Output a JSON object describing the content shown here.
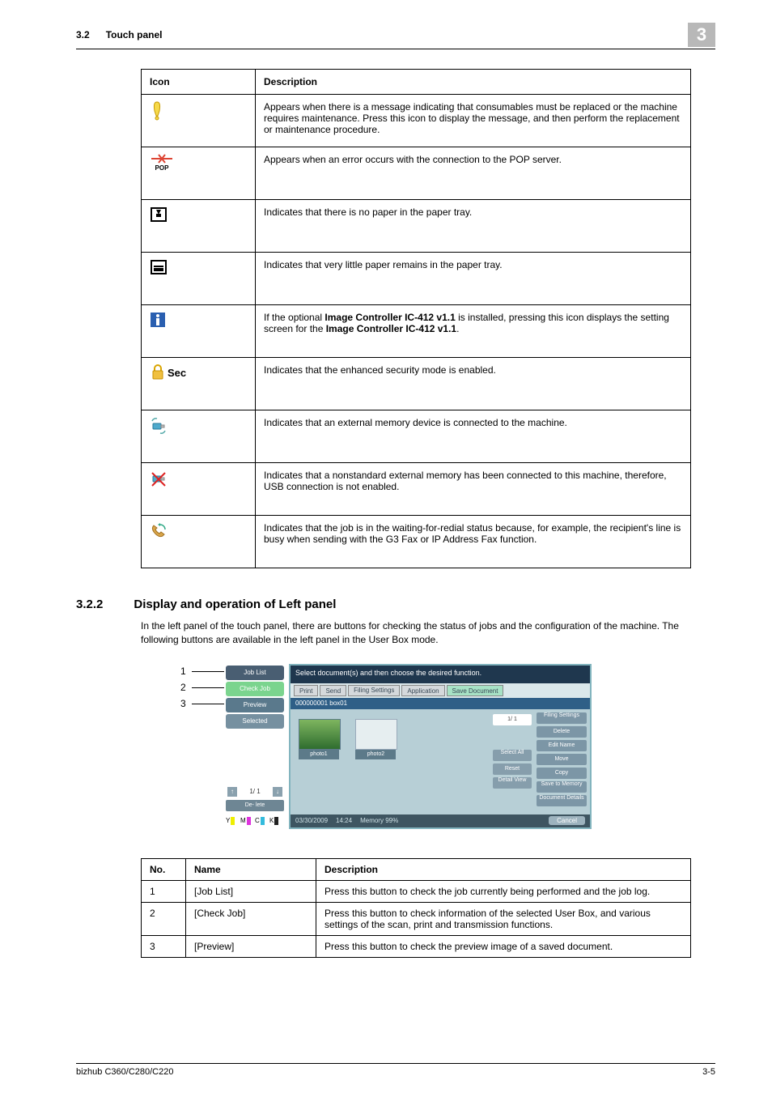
{
  "header": {
    "section_number": "3.2",
    "section_title": "Touch panel",
    "chapter": "3"
  },
  "table1": {
    "head_icon": "Icon",
    "head_desc": "Description",
    "rows": {
      "r1": {
        "name": "exclamation-icon",
        "desc": "Appears when there is a message indicating that consumables must be replaced or the machine requires maintenance. Press this icon to display the message, and then perform the replacement or maintenance procedure."
      },
      "r2": {
        "name": "pop-error-icon",
        "desc": "Appears when an error occurs with the connection to the POP server."
      },
      "r3": {
        "name": "no-paper-icon",
        "desc": "Indicates that there is no paper in the paper tray."
      },
      "r4": {
        "name": "low-paper-icon",
        "desc": "Indicates that very little paper remains in the paper tray."
      },
      "r5": {
        "name": "info-icon",
        "desc_pre": "If the optional ",
        "bold1": "Image Controller IC-412 v1.1",
        "desc_mid": " is installed, pressing this icon displays the setting screen for the ",
        "bold2": "Image Controller IC-412 v1.1",
        "desc_post": "."
      },
      "r6": {
        "name": "security-icon",
        "label": " Sec",
        "desc": "Indicates that the enhanced security mode is enabled."
      },
      "r7": {
        "name": "external-memory-icon",
        "desc": "Indicates that an external memory device is connected to the machine."
      },
      "r8": {
        "name": "external-memory-disabled-icon",
        "desc": "Indicates that a nonstandard external memory has been connected to this machine, therefore, USB connection is not enabled."
      },
      "r9": {
        "name": "redial-wait-icon",
        "desc": "Indicates that the job is in the waiting-for-redial status because, for example, the recipient's line is busy when sending with the G3 Fax or IP Address Fax function."
      }
    }
  },
  "section2": {
    "number": "3.2.2",
    "title": "Display and operation of Left panel",
    "intro": "In the left panel of the touch panel, there are buttons for checking the status of jobs and the configuration of the machine. The following buttons are available in the left panel in the User Box mode."
  },
  "screenshot": {
    "side1": "Job List",
    "side2": "Check Job",
    "side3": "Preview",
    "side4": "Selected Documents",
    "pager": "1/  1",
    "del": "De-\nlete",
    "toptext": "Select document(s) and then\nchoose the desired function.",
    "tabs": {
      "print": "Print",
      "send": "Send",
      "filing": "Filing\nSettings",
      "app": "Application",
      "save": "Save Document"
    },
    "crumb": "000000001   box01",
    "thumb1": "photo1",
    "thumb2": "photo2",
    "page": "1/  1",
    "sel": "Select\nAll",
    "reset": "Reset",
    "detail": "Detail\nView",
    "r1": "Filing\nSettings",
    "r2": "Delete",
    "r3": "Edit Name",
    "r4": "Move",
    "r5": "Copy",
    "r6": "Save to\nMemory",
    "r7": "Document\nDetails",
    "foot_date": "03/30/2009",
    "foot_time": "14:24",
    "foot_mem": "Memory      99%",
    "cancel": "Cancel",
    "callout1": "1",
    "callout2": "2",
    "callout3": "3"
  },
  "table2": {
    "h_no": "No.",
    "h_name": "Name",
    "h_desc": "Description",
    "rows": {
      "a": {
        "no": "1",
        "name": "[Job List]",
        "desc": "Press this button to check the job currently being performed and the job log."
      },
      "b": {
        "no": "2",
        "name": "[Check Job]",
        "desc": "Press this button to check information of the selected User Box, and various settings of the scan, print and transmission functions."
      },
      "c": {
        "no": "3",
        "name": "[Preview]",
        "desc": "Press this button to check the preview image of a saved document."
      }
    }
  },
  "footer": {
    "left": "bizhub C360/C280/C220",
    "right": "3-5"
  }
}
